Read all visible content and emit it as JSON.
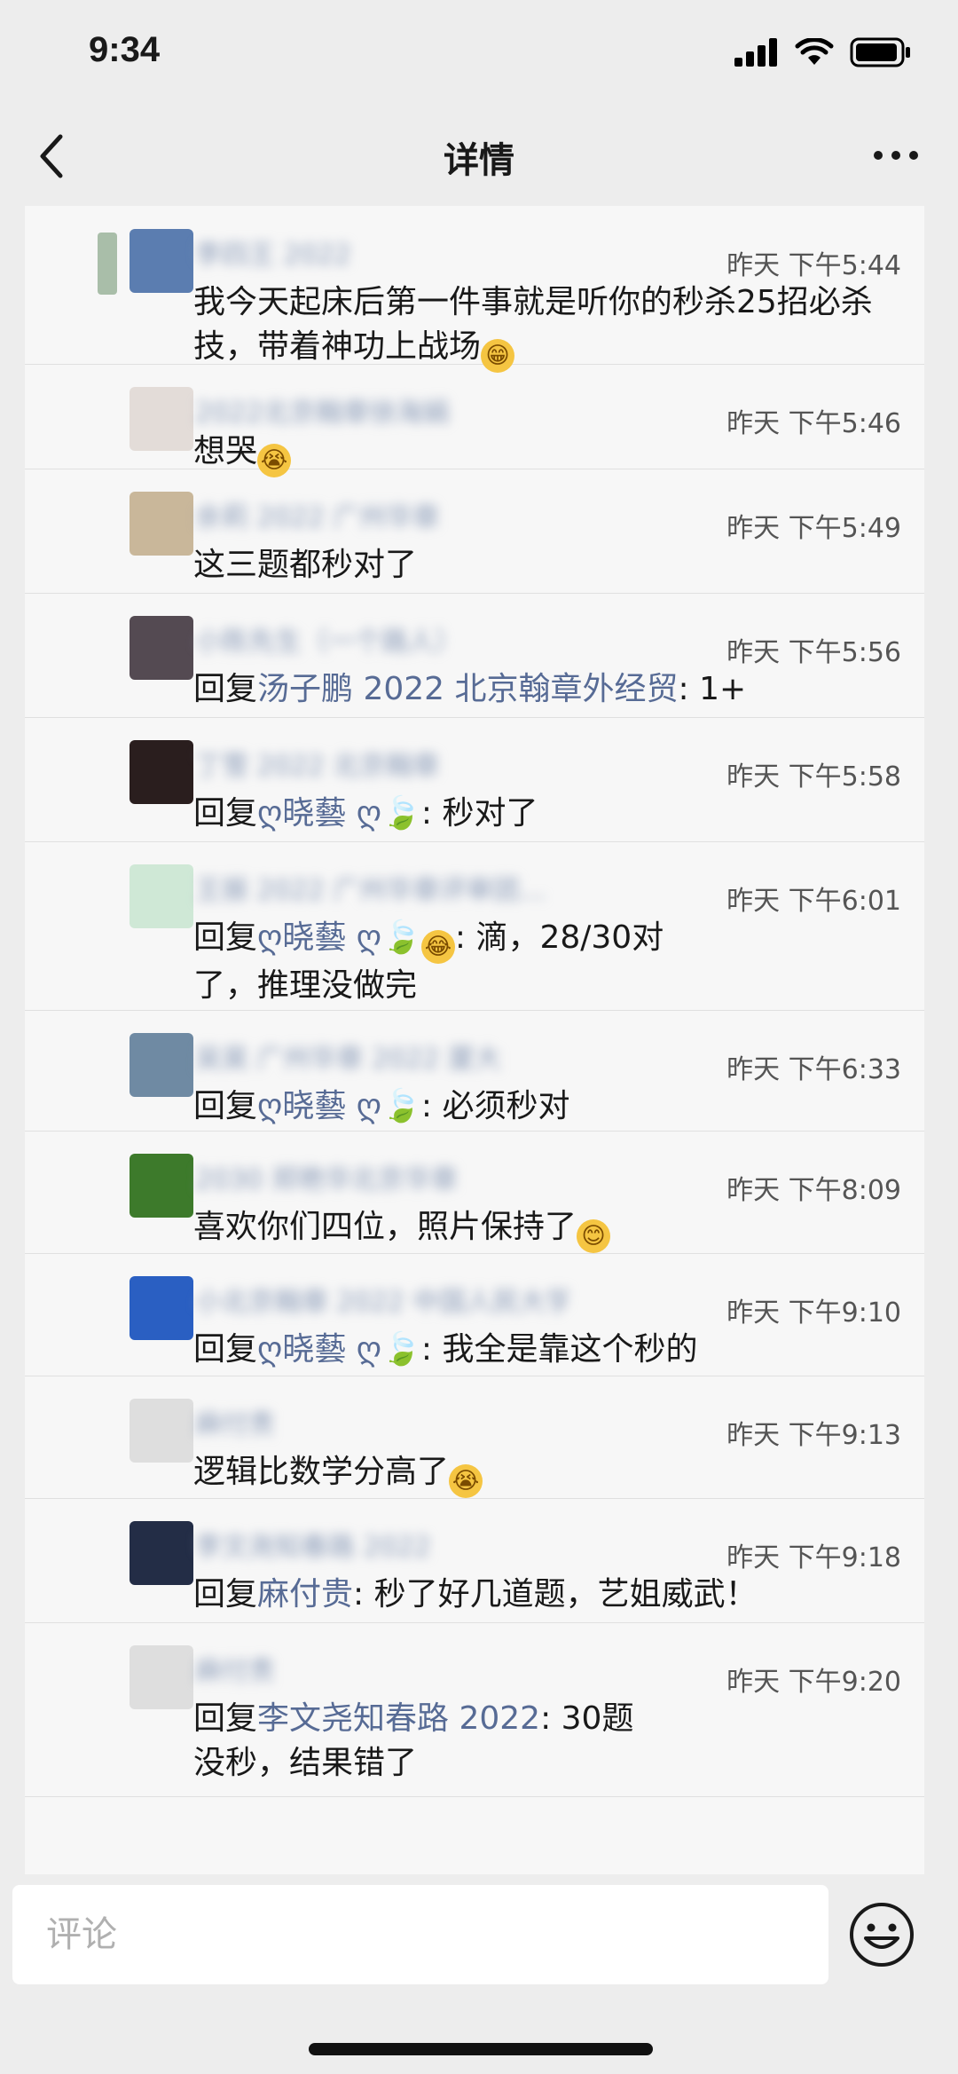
{
  "status": {
    "time": "9:34"
  },
  "header": {
    "title": "详情"
  },
  "comments": [
    {
      "text": "我今天起床后第一件事就是听你的秒杀25招必杀技，带着神功上战场",
      "emoji": "😁",
      "time": "昨天 下午5:44",
      "name": "李四王 2022"
    },
    {
      "text": "想哭",
      "emoji": "😭",
      "time": "昨天 下午5:46",
      "name": "2022北京翰章徐海娟"
    },
    {
      "text": "这三题都秒对了",
      "time": "昨天 下午5:49",
      "name": "余莉 2022 广州华章"
    },
    {
      "reply_prefix": "回复",
      "reply_to": "汤子鹏 2022 北京翰章外经贸",
      "text": ": 1+",
      "time": "昨天 下午5:56",
      "name": "小陈先生（一个路人）"
    },
    {
      "reply_prefix": "回复",
      "reply_to": "ღ晓藝 ღ",
      "text": ": 秒对了",
      "time": "昨天 下午5:58",
      "name": "丁雪 2022 北京翰章"
    },
    {
      "reply_prefix": "回复",
      "reply_to": "ღ晓藝 ღ",
      "text": ": 滴，28/30对了，推理没做完",
      "emoji": "😂",
      "time": "昨天 下午6:01",
      "name": "王振 2022 广州华章评审团…"
    },
    {
      "reply_prefix": "回复",
      "reply_to": "ღ晓藝 ღ",
      "text": ": 必须秒对",
      "time": "昨天 下午6:33",
      "name": "吴昊 广州华章 2022 厦大"
    },
    {
      "text": "喜欢你们四位，照片保持了",
      "emoji": "😊",
      "time": "昨天 下午8:09",
      "name": "2030 郑艳华北京华章"
    },
    {
      "reply_prefix": "回复",
      "reply_to": "ღ晓藝 ღ",
      "text": ": 我全是靠这个秒的",
      "time": "昨天 下午9:10",
      "name": "小北京翰章 2022 中国人民大学"
    },
    {
      "text": "逻辑比数学分高了",
      "emoji": "😭",
      "time": "昨天 下午9:13",
      "name": "麻付贵"
    },
    {
      "reply_prefix": "回复",
      "reply_to": "麻付贵",
      "text": ": 秒了好几道题，艺姐威武！",
      "time": "昨天 下午9:18",
      "name": "李文尧知春路 2022"
    },
    {
      "reply_prefix": "回复",
      "reply_to": "李文尧知春路 2022",
      "text": ": 30题没秒，结果错了",
      "time": "昨天 下午9:20",
      "name": "麻付贵"
    }
  ],
  "footer": {
    "placeholder": "评论"
  },
  "colors": {
    "link": "#576b95",
    "background": "#ededed",
    "list_bg": "#f7f7f7"
  }
}
